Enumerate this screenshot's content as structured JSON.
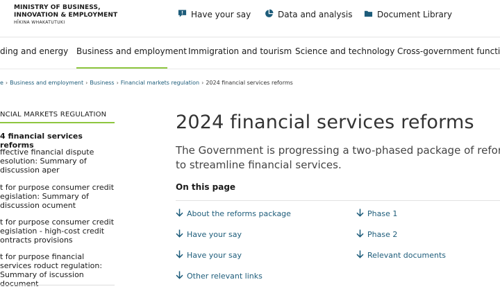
{
  "header": {
    "logo": {
      "line1": "MINISTRY OF BUSINESS,",
      "line2": "INNOVATION & EMPLOYMENT",
      "line3": "HĪKINA WHAKATUTUKI"
    },
    "utility_links": [
      {
        "label": "Have your say",
        "icon": "speech-bubble-icon"
      },
      {
        "label": "Data and analysis",
        "icon": "pie-chart-icon"
      },
      {
        "label": "Document Library",
        "icon": "folder-icon"
      }
    ]
  },
  "topnav": {
    "items": [
      {
        "label": "ding and energy"
      },
      {
        "label": "Business and employment",
        "active": true
      },
      {
        "label": "Immigration and tourism"
      },
      {
        "label": "Science and technology"
      },
      {
        "label": "Cross-government functions"
      }
    ],
    "accent_color": "#8dc63f"
  },
  "breadcrumb": {
    "items": [
      "e",
      "Business and employment",
      "Business",
      "Financial markets regulation"
    ],
    "current": "2024 financial services reforms",
    "separator": "›"
  },
  "sidebar": {
    "title": "NCIAL MARKETS REGULATION",
    "items": [
      {
        "label": "4 financial services reforms",
        "active": true
      },
      {
        "label": "ffective financial dispute esolution: Summary of discussion aper"
      },
      {
        "label": "t for purpose consumer credit egislation: Summary of discussion ocument"
      },
      {
        "label": "t for purpose consumer credit egislation - high-cost credit ontracts provisions"
      },
      {
        "label": "t for purpose financial services roduct regulation: Summary of iscussion document"
      }
    ]
  },
  "main": {
    "title": "2024 financial services reforms",
    "intro": "The Government is progressing a two-phased package of reforms to streamline financial services.",
    "on_this_page": {
      "heading": "On this page",
      "links_left": [
        "About the reforms package",
        "Have your say",
        "Have your say",
        "Other relevant links"
      ],
      "links_right": [
        "Phase 1",
        "Phase 2",
        "Relevant documents"
      ]
    }
  },
  "colors": {
    "link": "#1d5c7a",
    "text": "#333333",
    "accent": "#8dc63f"
  }
}
